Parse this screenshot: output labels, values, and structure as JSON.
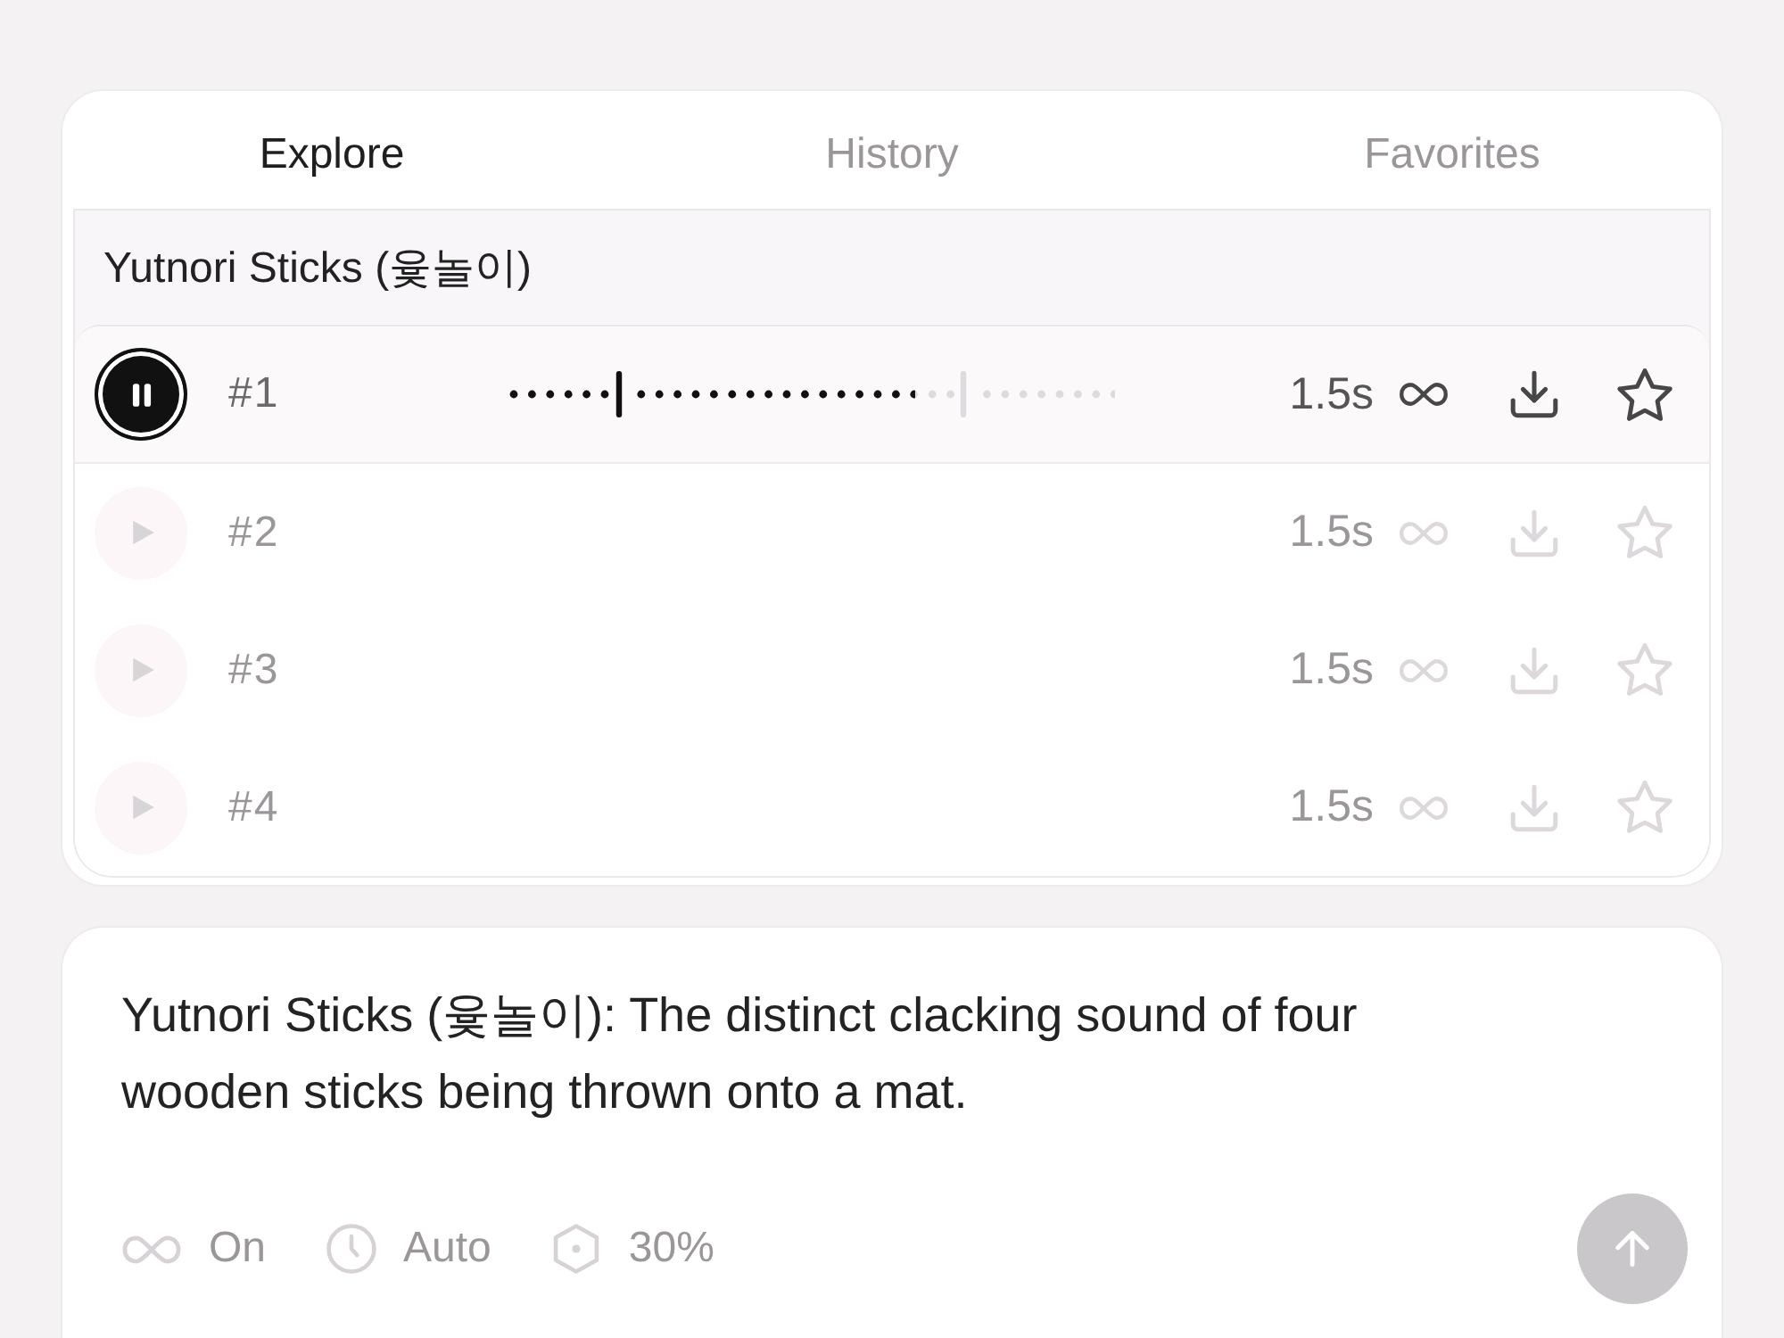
{
  "tabs": [
    {
      "label": "Explore",
      "selected": true
    },
    {
      "label": "History",
      "selected": false
    },
    {
      "label": "Favorites",
      "selected": false
    }
  ],
  "sound_group": {
    "title": "Yutnori Sticks (윷놀이)",
    "variations": [
      {
        "label": "#1",
        "duration": "1.5s",
        "selected": true,
        "playing": true,
        "level": 0.67
      },
      {
        "label": "#2",
        "duration": "1.5s",
        "selected": false,
        "playing": false
      },
      {
        "label": "#3",
        "duration": "1.5s",
        "selected": false,
        "playing": false
      },
      {
        "label": "#4",
        "duration": "1.5s",
        "selected": false,
        "playing": false
      }
    ]
  },
  "prompt": {
    "value": "Yutnori Sticks (윷놀이): The distinct clacking sound of four wooden sticks being thrown onto a mat.",
    "options": [
      {
        "kind": "loop",
        "label": "On"
      },
      {
        "kind": "duration",
        "label": "Auto"
      },
      {
        "kind": "influence",
        "label": "30%"
      }
    ]
  }
}
